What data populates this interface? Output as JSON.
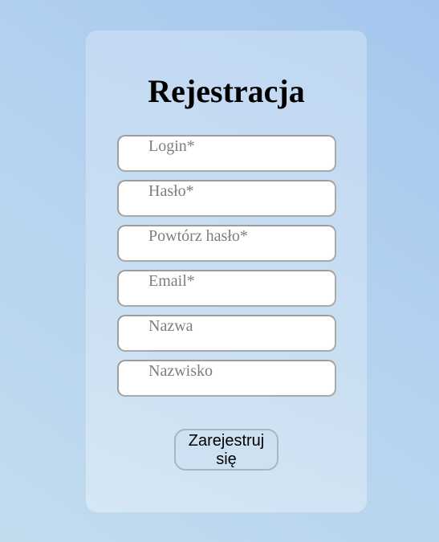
{
  "form": {
    "title": "Rejestracja",
    "fields": [
      {
        "placeholder": "Login*",
        "value": ""
      },
      {
        "placeholder": "Hasło*",
        "value": ""
      },
      {
        "placeholder": "Powtórz hasło*",
        "value": ""
      },
      {
        "placeholder": "Email*",
        "value": ""
      },
      {
        "placeholder": "Nazwa",
        "value": ""
      },
      {
        "placeholder": "Nazwisko",
        "value": ""
      }
    ],
    "submit_label": "Zarejestruj się"
  },
  "colors": {
    "background": "#a4c6ee",
    "card": "#c8ddf2",
    "field_border": "#a9a9a9",
    "placeholder": "#7d7d7d"
  }
}
